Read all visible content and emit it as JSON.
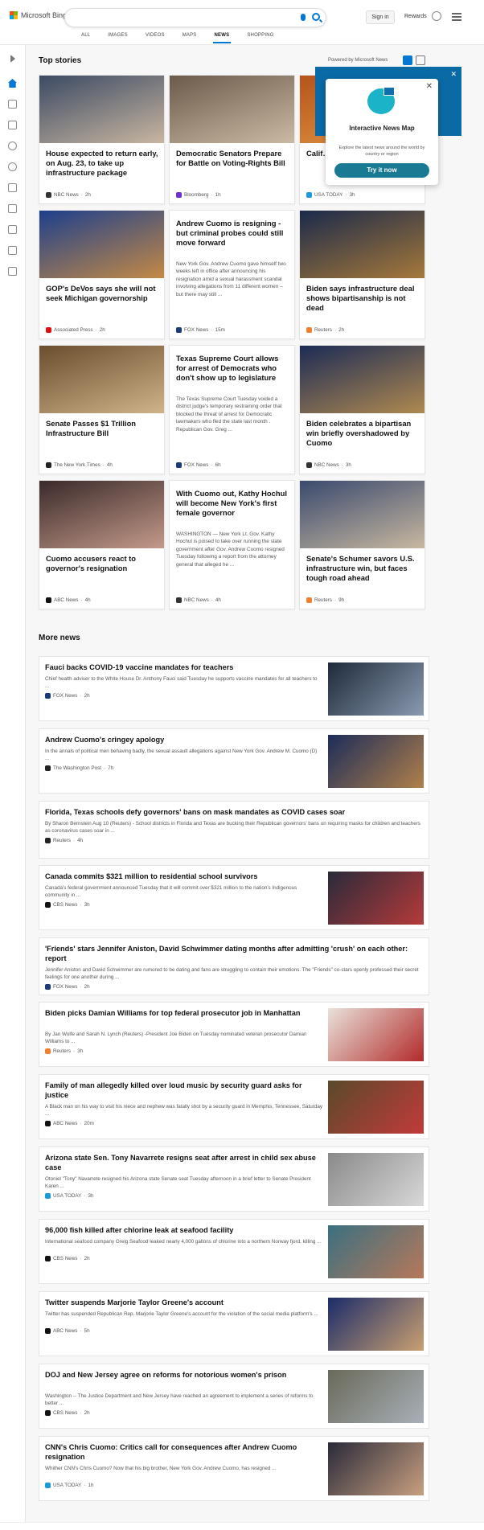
{
  "header": {
    "logo_text": "Microsoft Bing",
    "logo_colors": [
      "#f25022",
      "#7fba00",
      "#00a4ef",
      "#ffb900"
    ],
    "search_value": "",
    "signin_label": "Sign in",
    "rewards_label": "Rewards",
    "tabs": [
      "ALL",
      "IMAGES",
      "VIDEOS",
      "MAPS",
      "NEWS",
      "SHOPPING"
    ],
    "active_tab": "NEWS"
  },
  "sidebar": {
    "icons": [
      "chevron-right-icon",
      "home-icon",
      "tools-icon",
      "flag-icon",
      "location-pin-icon",
      "globe-icon",
      "scales-icon",
      "rocket-icon",
      "entertainment-icon",
      "bank-icon",
      "money-icon"
    ]
  },
  "top_stories": {
    "heading": "Top stories",
    "powered_by": "Powered by Microsoft News",
    "cards": [
      {
        "title": "House expected to return early, on Aug. 23, to take up infrastructure package",
        "source": "NBC News",
        "time": "2h",
        "src_color": "#333",
        "img_colors": [
          "#3b4a63",
          "#c9b6a1"
        ]
      },
      {
        "title": "Democratic Senators Prepare for Battle on Voting-Rights Bill",
        "source": "Bloomberg",
        "time": "1h",
        "src_color": "#6b2fd4",
        "img_colors": [
          "#6b5a4a",
          "#cbbba5"
        ]
      },
      {
        "title": "Calif… destr… hot w…",
        "source": "USA TODAY",
        "time": "3h",
        "src_color": "#1a9be0",
        "img_colors": [
          "#b4541d",
          "#e39a45"
        ]
      },
      {
        "title": "GOP's DeVos says she will not seek Michigan governorship",
        "source": "Associated Press",
        "time": "2h",
        "src_color": "#d11",
        "img_colors": [
          "#1d3f8c",
          "#c48a45"
        ]
      },
      {
        "title": "Andrew Cuomo is resigning - but criminal probes could still move forward",
        "snippet": "New York Gov. Andrew Cuomo gave himself two weeks left in office after announcing his resignation amid a sexual harassment scandal involving allegations from 11 different women – but there may still ...",
        "source": "FOX News",
        "time": "15m",
        "src_color": "#1b3a7a"
      },
      {
        "title": "Biden says infrastructure deal shows bipartisanship is not dead",
        "source": "Reuters",
        "time": "2h",
        "src_color": "#f08030",
        "img_colors": [
          "#1b2a4a",
          "#a6793a"
        ]
      },
      {
        "title": "Senate Passes $1 Trillion Infrastructure Bill",
        "source": "The New York Times",
        "time": "4h",
        "src_color": "#222",
        "img_colors": [
          "#6a4e2e",
          "#d0b48a"
        ]
      },
      {
        "title": "Texas Supreme Court allows for arrest of Democrats who don't show up to legislature",
        "snippet": "The Texas Supreme Court Tuesday voided a district judge's temporary restraining order that blocked the threat of arrest for Democratic lawmakers who fled the state last month . Republican Gov. Greg ...",
        "source": "FOX News",
        "time": "6h",
        "src_color": "#1b3a7a"
      },
      {
        "title": "Biden celebrates a bipartisan win briefly overshadowed by Cuomo",
        "source": "NBC News",
        "time": "3h",
        "src_color": "#333",
        "img_colors": [
          "#1c2b55",
          "#b08a50"
        ]
      },
      {
        "title": "Cuomo accusers react to governor's resignation",
        "source": "ABC News",
        "time": "4h",
        "src_color": "#111",
        "img_colors": [
          "#3a2a2a",
          "#c49a8a"
        ]
      },
      {
        "title": "With Cuomo out, Kathy Hochul will become New York's first female governor",
        "snippet": "WASHINGTON — New York Lt. Gov. Kathy Hochul is poised to take over running the state government after Gov. Andrew Cuomo resigned Tuesday following a report from the attorney general that alleged he ...",
        "source": "NBC News",
        "time": "4h",
        "src_color": "#333"
      },
      {
        "title": "Senate's Schumer savors U.S. infrastructure win, but faces tough road ahead",
        "source": "Reuters",
        "time": "9h",
        "src_color": "#f08030",
        "img_colors": [
          "#3a4a6e",
          "#c8b8a0"
        ]
      }
    ]
  },
  "map_popup": {
    "title": "Interactive News Map",
    "description": "Explore the latest news around the world by country or region",
    "button_label": "Try it now"
  },
  "more_news": {
    "heading": "More news",
    "items": [
      {
        "title": "Fauci backs COVID-19 vaccine mandates for teachers",
        "snippet": "Chief health adviser to the White House Dr. Anthony Fauci said Tuesday he supports vaccine mandates for all teachers to ...",
        "source": "FOX News",
        "time": "2h",
        "src_color": "#1b3a7a",
        "img_colors": [
          "#1e2a3a",
          "#8a9ab0"
        ]
      },
      {
        "title": "Andrew Cuomo's cringey apology",
        "snippet": "In the annals of political men behaving badly, the sexual assault allegations against New York Gov. Andrew M. Cuomo (D) ...",
        "source": "The Washington Post",
        "time": "7h",
        "src_color": "#222",
        "img_colors": [
          "#1c2c5a",
          "#b0804a"
        ]
      },
      {
        "title": "Florida, Texas schools defy governors' bans on mask mandates as COVID cases soar",
        "snippet": "By Sharon Bernstein Aug 10 (Reuters) - School districts in Florida and Texas are bucking their Republican governors' bans on requiring masks for children and teachers as coronavirus cases soar in ...",
        "source": "Reuters",
        "time": "4h",
        "src_color": "#222"
      },
      {
        "title": "Canada commits $321 million to residential school survivors",
        "snippet": "Canada's federal government announced Tuesday that it will commit over $321 million to the nation's Indigenous community in ...",
        "source": "CBS News",
        "time": "3h",
        "src_color": "#111",
        "img_colors": [
          "#2a2a3a",
          "#b53a3a"
        ]
      },
      {
        "title": "'Friends' stars Jennifer Aniston, David Schwimmer dating months after admitting 'crush' on each other: report",
        "snippet": "Jennifer Aniston and David Schwimmer are rumored to be dating and fans are struggling to contain their emotions. The \"Friends\" co-stars openly professed their secret feelings for one another during ...",
        "source": "FOX News",
        "time": "2h",
        "src_color": "#1b3a7a"
      },
      {
        "title": "Biden picks Damian Williams for top federal prosecutor job in Manhattan",
        "snippet": "By Jan Wolfe and Sarah N. Lynch (Reuters) -President Joe Biden on Tuesday nominated veteran prosecutor Damian Williams to ...",
        "source": "Reuters",
        "time": "3h",
        "src_color": "#f08030",
        "img_colors": [
          "#e9e2da",
          "#b22a2a"
        ]
      },
      {
        "title": "Family of man allegedly killed over loud music by security guard asks for justice",
        "snippet": "A Black man on his way to visit his niece and nephew was fatally shot by a security guard in Memphis, Tennessee, Saturday ...",
        "source": "ABC News",
        "time": "20m",
        "src_color": "#111",
        "img_colors": [
          "#5a4a2a",
          "#c23a3a"
        ]
      },
      {
        "title": "Arizona state Sen. Tony Navarrete resigns seat after arrest in child sex abuse case",
        "snippet": "Otoniel \"Tony\" Navarrete resigned his Arizona state Senate seat Tuesday afternoon in a brief letter to Senate President Karen ...",
        "source": "USA TODAY",
        "time": "3h",
        "src_color": "#1a9be0",
        "img_colors": [
          "#8a8a8a",
          "#d8d8d8"
        ]
      },
      {
        "title": "96,000 fish killed after chlorine leak at seafood facility",
        "snippet": "International seafood company Greig Seafood leaked nearly 4,000 gallons of chlorine into a northern Norway fjord, killing ...",
        "source": "CBS News",
        "time": "2h",
        "src_color": "#111",
        "img_colors": [
          "#3a7080",
          "#b8785a"
        ]
      },
      {
        "title": "Twitter suspends Marjorie Taylor Greene's account",
        "snippet": "Twitter has suspended Republican Rep. Marjorie Taylor Greene's account for the violation of the social media platform's ...",
        "source": "ABC News",
        "time": "5h",
        "src_color": "#111",
        "img_colors": [
          "#1c2c6a",
          "#c9a070"
        ]
      },
      {
        "title": "DOJ and New Jersey agree on reforms for notorious women's prison",
        "snippet": "Washington -- The Justice Department and New Jersey have reached an agreement to implement a series of reforms to better ...",
        "source": "CBS News",
        "time": "2h",
        "src_color": "#111",
        "img_colors": [
          "#6a6a5a",
          "#a8b0b8"
        ]
      },
      {
        "title": "CNN's Chris Cuomo: Critics call for consequences after Andrew Cuomo resignation",
        "snippet": "Whither CNN's Chris Cuomo? Now that his big brother, New York Gov. Andrew Cuomo, has resigned ...",
        "source": "USA TODAY",
        "time": "1h",
        "src_color": "#1a9be0",
        "img_colors": [
          "#2a2a3a",
          "#c8a080"
        ]
      }
    ]
  }
}
